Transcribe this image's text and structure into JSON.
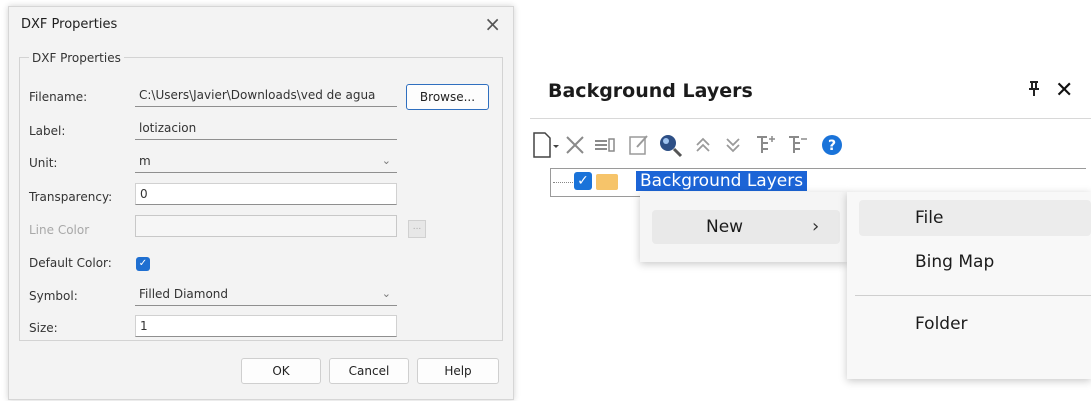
{
  "dialog": {
    "title": "DXF Properties",
    "group_label": "DXF Properties",
    "filename_label": "Filename:",
    "filename_value": "C:\\Users\\Javier\\Downloads\\ved de agua",
    "browse_label": "Browse...",
    "label_label": "Label:",
    "label_value": "lotizacion",
    "unit_label": "Unit:",
    "unit_value": "m",
    "transparency_label": "Transparency:",
    "transparency_value": "0",
    "line_color_label": "Line Color",
    "line_color_button": "...",
    "default_color_label": "Default Color:",
    "default_color_checked": true,
    "symbol_label": "Symbol:",
    "symbol_value": "Filled Diamond",
    "size_label": "Size:",
    "size_value": "1",
    "ok_label": "OK",
    "cancel_label": "Cancel",
    "help_label": "Help",
    "close_glyph": "×"
  },
  "panel": {
    "title": "Background Layers",
    "pin_glyph": "ꟸ",
    "close_glyph": "✕",
    "toolbar_icons": [
      "new-layer-icon",
      "delete-icon",
      "properties-icon",
      "edit-icon",
      "zoom-to-layer-icon",
      "move-up-icon",
      "move-down-icon",
      "expand-icon",
      "collapse-icon",
      "help-icon"
    ],
    "tree": {
      "root_label": "Background Layers",
      "checked": true
    },
    "context_menu": {
      "new_label": "New",
      "arrow": "›",
      "submenu": [
        "File",
        "Bing Map",
        "Folder"
      ]
    }
  },
  "colors": {
    "accent": "#1f6fd1",
    "selection": "#1c64d6",
    "folder": "#f6c46a",
    "help": "#1a73d9"
  }
}
